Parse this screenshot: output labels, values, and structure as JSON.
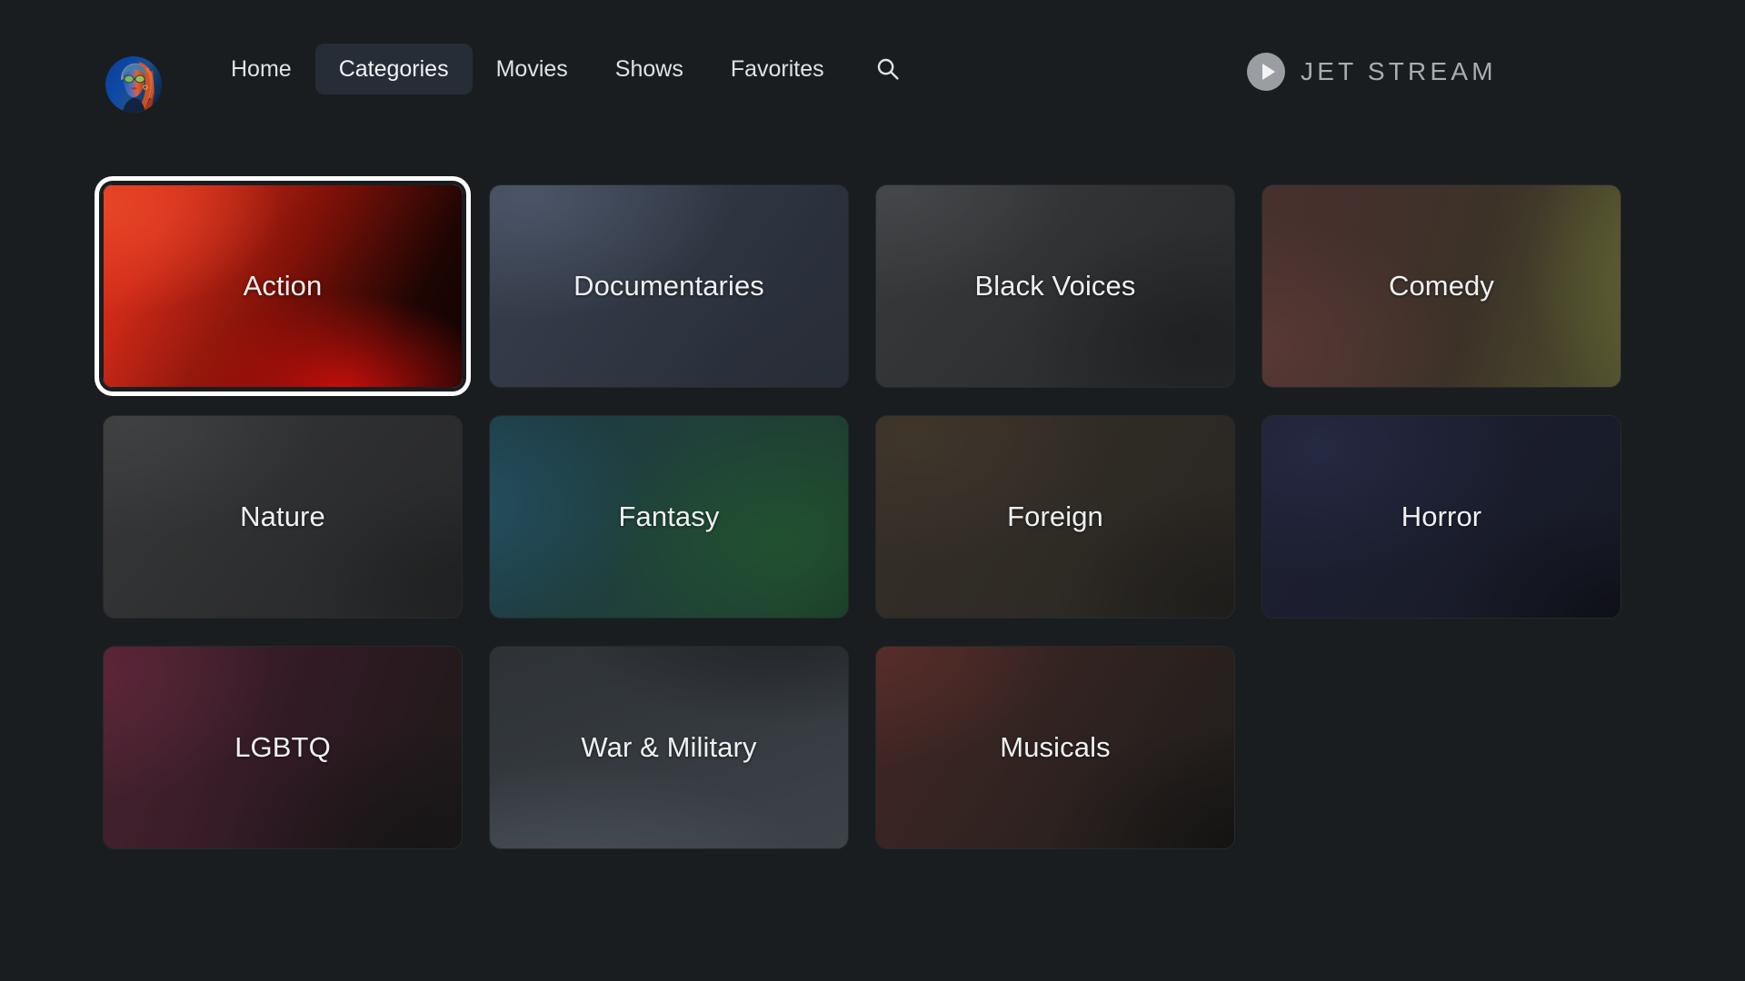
{
  "app": {
    "background_color": "#1a1d20",
    "brand_name": "JET STREAM",
    "brand_color": "#a9acb0",
    "accent_focus_color": "#ffffff"
  },
  "header": {
    "avatar_label": "user-avatar",
    "nav_items": [
      {
        "label": "Home",
        "active": false
      },
      {
        "label": "Categories",
        "active": true
      },
      {
        "label": "Movies",
        "active": false
      },
      {
        "label": "Shows",
        "active": false
      },
      {
        "label": "Favorites",
        "active": false
      }
    ],
    "search_icon": "search-icon",
    "brand": {
      "text": "JET STREAM",
      "mark_icon": "play-circle-icon"
    }
  },
  "main": {
    "grid": {
      "columns": 4,
      "rows": 3,
      "tiles": [
        {
          "label": "Action",
          "focused": true,
          "theme": "t-action",
          "accent": "#e3381f"
        },
        {
          "label": "Documentaries",
          "focused": false,
          "theme": "t-doc",
          "accent": "#3a4150"
        },
        {
          "label": "Black Voices",
          "focused": false,
          "theme": "t-black",
          "accent": "#3a3c3e"
        },
        {
          "label": "Comedy",
          "focused": false,
          "theme": "t-comedy",
          "accent": "#56562f"
        },
        {
          "label": "Nature",
          "focused": false,
          "theme": "t-nature",
          "accent": "#3a3b3c"
        },
        {
          "label": "Fantasy",
          "focused": false,
          "theme": "t-fantasy",
          "accent": "#1d3a46"
        },
        {
          "label": "Foreign",
          "focused": false,
          "theme": "t-foreign",
          "accent": "#38312a"
        },
        {
          "label": "Horror",
          "focused": false,
          "theme": "t-horror",
          "accent": "#1e2134"
        },
        {
          "label": "LGBTQ",
          "focused": false,
          "theme": "t-lgbtq",
          "accent": "#4a2431"
        },
        {
          "label": "War & Military",
          "focused": false,
          "theme": "t-war",
          "accent": "#3e444a"
        },
        {
          "label": "Musicals",
          "focused": false,
          "theme": "t-musicals",
          "accent": "#45292a"
        }
      ]
    }
  }
}
